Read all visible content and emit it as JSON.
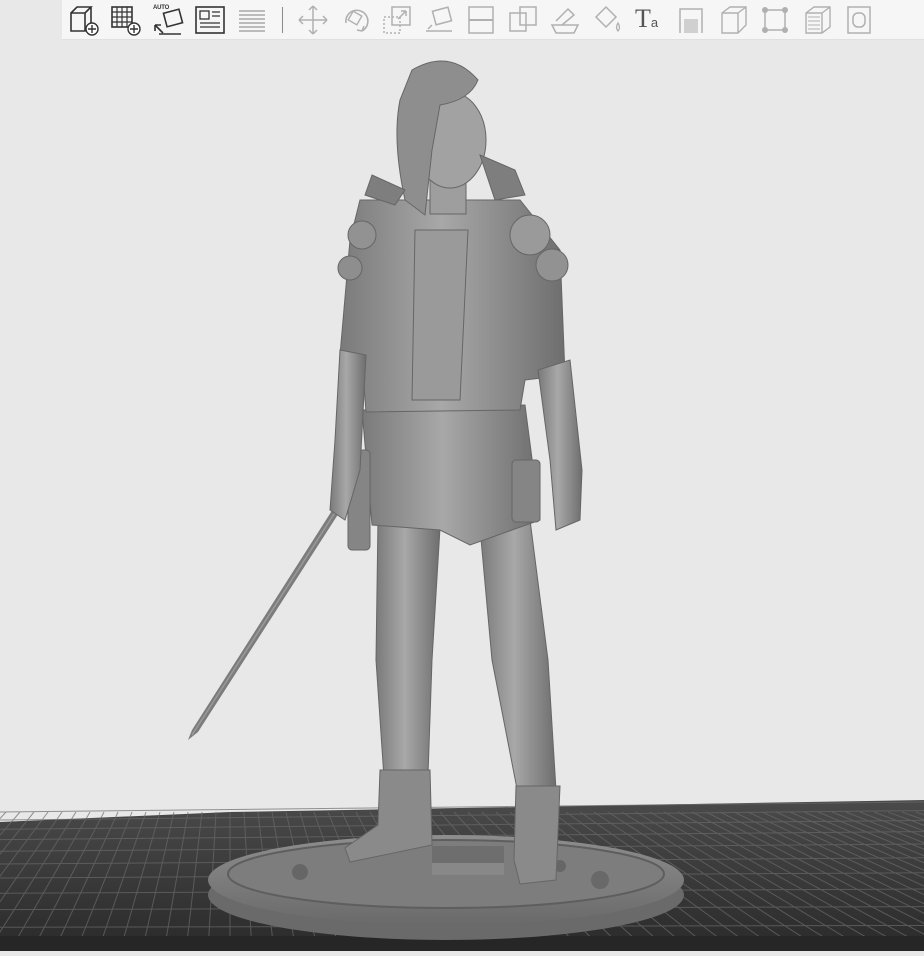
{
  "toolbar": {
    "buttons": [
      {
        "name": "add-object-button",
        "icon": "cube-plus-icon",
        "enabled": true
      },
      {
        "name": "add-grid-button",
        "icon": "grid-plus-icon",
        "enabled": true
      },
      {
        "name": "auto-arrange-button",
        "icon": "auto-arrange-icon",
        "enabled": true,
        "label": "AUTO"
      },
      {
        "name": "layout-button",
        "icon": "layout-panels-icon",
        "enabled": true
      },
      {
        "name": "layers-button",
        "icon": "layers-icon",
        "enabled": false
      },
      {
        "name": "move-button",
        "icon": "move-arrows-icon",
        "enabled": false
      },
      {
        "name": "rotate-button",
        "icon": "rotate-icon",
        "enabled": false
      },
      {
        "name": "scale-button",
        "icon": "scale-icon",
        "enabled": false
      },
      {
        "name": "lay-flat-button",
        "icon": "lay-flat-icon",
        "enabled": false
      },
      {
        "name": "cut-button",
        "icon": "cut-plane-icon",
        "enabled": false
      },
      {
        "name": "split-button",
        "icon": "split-icon",
        "enabled": false
      },
      {
        "name": "support-paint-button",
        "icon": "support-paint-icon",
        "enabled": false
      },
      {
        "name": "color-paint-button",
        "icon": "paint-bucket-icon",
        "enabled": false
      },
      {
        "name": "text-button",
        "icon": "text-icon",
        "enabled": true,
        "label": "T",
        "sublabel": "a"
      },
      {
        "name": "seam-button",
        "icon": "seam-icon",
        "enabled": false
      },
      {
        "name": "measure-button",
        "icon": "measure-box-icon",
        "enabled": false
      },
      {
        "name": "assembly-button",
        "icon": "assembly-frame-icon",
        "enabled": false
      },
      {
        "name": "variable-layer-button",
        "icon": "variable-layer-icon",
        "enabled": false
      },
      {
        "name": "shell-button",
        "icon": "shell-icon",
        "enabled": false
      }
    ]
  },
  "viewport": {
    "background": "#e8e8e8",
    "plate_color": "#3a3a3a",
    "model_color": "#8c8c8c",
    "model_name": "figure-with-sword"
  }
}
